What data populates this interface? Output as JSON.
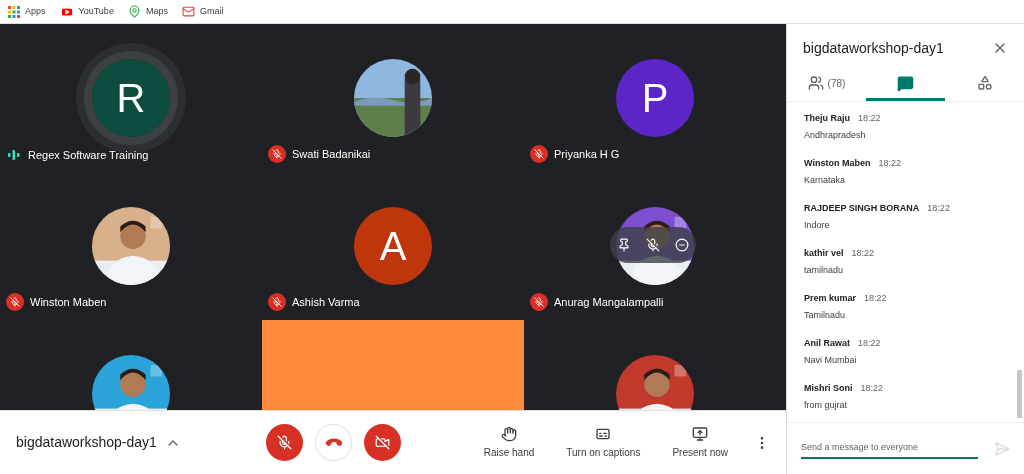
{
  "bookmarks": [
    {
      "kind": "apps",
      "label": "Apps"
    },
    {
      "kind": "youtube",
      "label": "YouTube"
    },
    {
      "kind": "maps",
      "label": "Maps"
    },
    {
      "kind": "gmail",
      "label": "Gmail"
    }
  ],
  "tiles": [
    {
      "kind": "letter",
      "letter": "R",
      "color": "#0d4d3f",
      "name": "Regex Software Training",
      "muted": false
    },
    {
      "kind": "picture",
      "name": "Swati Badanikai",
      "muted": true
    },
    {
      "kind": "letter",
      "letter": "P",
      "color": "#5b25c8",
      "name": "Priyanka H G",
      "muted": true
    },
    {
      "kind": "picture",
      "name": "Winston Maben",
      "muted": true
    },
    {
      "kind": "letter",
      "letter": "A",
      "color": "#bf360c",
      "name": "Ashish Varma",
      "muted": true
    },
    {
      "kind": "picture",
      "name": "Anurag Mangalampalli",
      "muted": true,
      "hover_controls": true
    },
    {
      "kind": "picture"
    },
    {
      "kind": "video"
    },
    {
      "kind": "picture"
    }
  ],
  "panel": {
    "title": "bigdataworkshop-day1",
    "tabs": [
      {
        "kind": "people",
        "label": "(78)",
        "selected": false
      },
      {
        "kind": "chat",
        "selected": true
      },
      {
        "kind": "activities",
        "selected": false
      }
    ],
    "messages": [
      {
        "sender": "Theju Raju",
        "time": "18:22",
        "text": "Andhrapradesh"
      },
      {
        "sender": "Winston Maben",
        "time": "18:22",
        "text": "Karnataka"
      },
      {
        "sender": "RAJDEEP SINGH BORANA",
        "time": "18:22",
        "text": "Indore"
      },
      {
        "sender": "kathir vel",
        "time": "18:22",
        "text": "tamilnadu"
      },
      {
        "sender": "Prem kumar",
        "time": "18:22",
        "text": "Tamilnadu"
      },
      {
        "sender": "Anil Rawat",
        "time": "18:22",
        "text": "Navi Mumbai"
      },
      {
        "sender": "Mishri Soni",
        "time": "18:22",
        "text": "from gujrat"
      }
    ],
    "input": {
      "placeholder": "Send a message to everyone"
    }
  },
  "bottom_bar": {
    "meeting_title": "bigdataworkshop-day1",
    "mic": {
      "on": false
    },
    "camera": {
      "on": false
    },
    "actions": [
      {
        "kind": "hand",
        "label": "Raise hand"
      },
      {
        "kind": "captions",
        "label": "Turn on captions"
      },
      {
        "kind": "present",
        "label": "Present now"
      }
    ]
  }
}
